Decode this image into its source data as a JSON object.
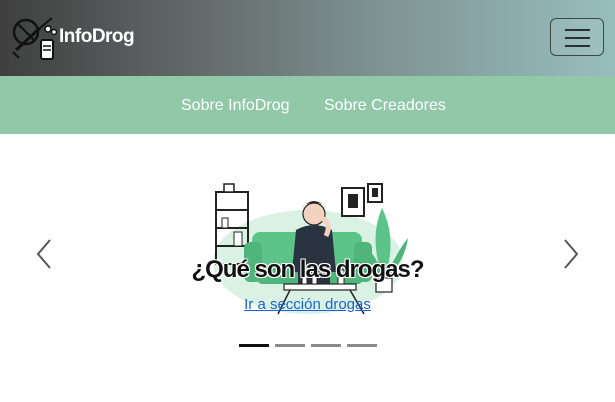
{
  "header": {
    "brand": "InfoDrog",
    "logo_icon": "drug-pills-syringe-icon",
    "menu_icon": "hamburger-menu-icon"
  },
  "nav": {
    "items": [
      {
        "label": "Sobre InfoDrog"
      },
      {
        "label": "Sobre Creadores"
      }
    ]
  },
  "carousel": {
    "slide_title": "¿Qué son las drogas?",
    "slide_link": "Ir a sección drogas",
    "illustration": "person-with-drugs-on-couch-illustration",
    "prev_icon": "chevron-left-icon",
    "next_icon": "chevron-right-icon",
    "indicators": [
      true,
      false,
      false,
      false
    ]
  },
  "colors": {
    "accent": "#90c8a8",
    "illustration_green": "#5dc489",
    "link": "#1a63d6"
  }
}
